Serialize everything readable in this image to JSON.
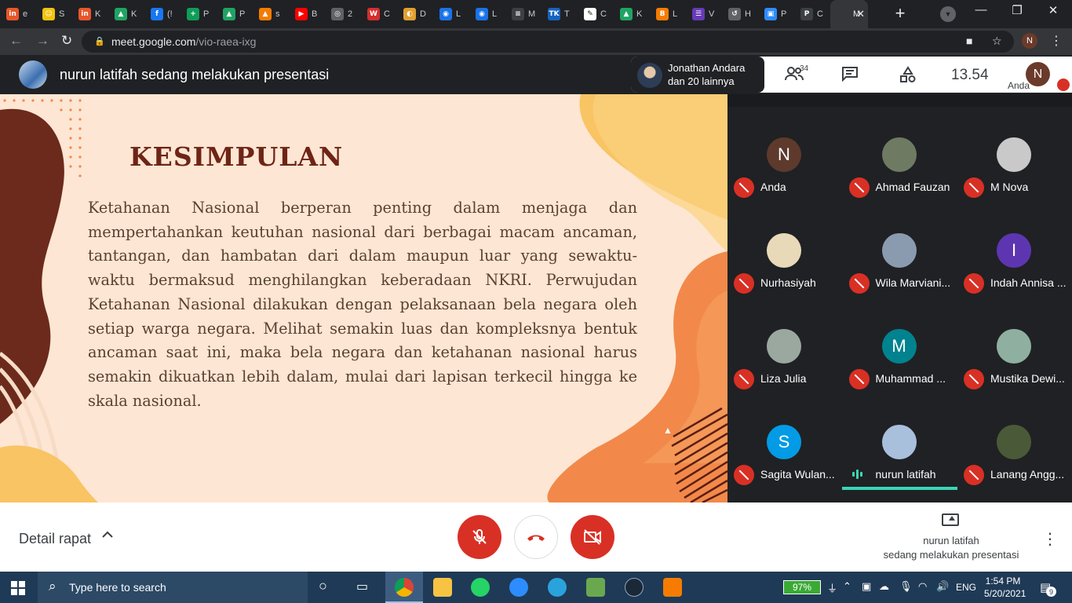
{
  "browser": {
    "tabs": [
      {
        "title": "e",
        "favicon": "in",
        "color": "#e8562a"
      },
      {
        "title": "S",
        "favicon": "☺",
        "color": "#f4c20d"
      },
      {
        "title": "K",
        "favicon": "in",
        "color": "#e8562a"
      },
      {
        "title": "K",
        "favicon": "▲",
        "color": "#1fa463"
      },
      {
        "title": "(!",
        "favicon": "f",
        "color": "#1877f2"
      },
      {
        "title": "P",
        "favicon": "+",
        "color": "#0f9d58"
      },
      {
        "title": "P",
        "favicon": "▲",
        "color": "#1fa463"
      },
      {
        "title": "s",
        "favicon": "▲",
        "color": "#f57c00"
      },
      {
        "title": "B",
        "favicon": "▶",
        "color": "#ff0000"
      },
      {
        "title": "2",
        "favicon": "◎",
        "color": "#5f6368"
      },
      {
        "title": "C",
        "favicon": "W",
        "color": "#d32f2f"
      },
      {
        "title": "D",
        "favicon": "◐",
        "color": "#e0a030"
      },
      {
        "title": "L",
        "favicon": "◉",
        "color": "#1a73e8"
      },
      {
        "title": "L",
        "favicon": "◉",
        "color": "#1a73e8"
      },
      {
        "title": "M",
        "favicon": "≡",
        "color": "#3c4043"
      },
      {
        "title": "T",
        "favicon": "TK",
        "color": "#1565c0"
      },
      {
        "title": "C",
        "favicon": "✎",
        "color": "#ffffff"
      },
      {
        "title": "K",
        "favicon": "▲",
        "color": "#1fa463"
      },
      {
        "title": "L",
        "favicon": "B",
        "color": "#f57c00"
      },
      {
        "title": "V",
        "favicon": "☰",
        "color": "#673ab7"
      },
      {
        "title": "H",
        "favicon": "↺",
        "color": "#5f6368"
      },
      {
        "title": "P",
        "favicon": "▣",
        "color": "#2d8cff"
      },
      {
        "title": "C",
        "favicon": "P",
        "color": "#3c4043"
      },
      {
        "title": "M",
        "favicon": "",
        "color": "#35363a"
      }
    ],
    "new_tab": "+",
    "url_host": "meet.google.com",
    "url_path": "/vio-raea-ixg",
    "profile_initial": "N",
    "window_controls": {
      "minimize": "—",
      "restore": "❐",
      "close": "✕"
    }
  },
  "meet_header": {
    "presenter_title": "nurun latifah sedang melakukan presentasi",
    "pinned_line1": "Jonathan Andara",
    "pinned_line2": "dan 20 lainnya",
    "participant_count": "34",
    "time": "13.54",
    "self_label": "Anda",
    "self_initial": "N"
  },
  "slide": {
    "title": "KESIMPULAN",
    "body": "Ketahanan Nasional berperan penting dalam menjaga dan mempertahankan keutuhan nasional dari berbagai macam ancaman, tantangan, dan hambatan dari dalam maupun luar yang sewaktu-waktu bermaksud menghilangkan keberadaan NKRI.  Perwujudan Ketahanan Nasional dilakukan dengan pelaksanaan bela negara oleh setiap warga negara. Melihat semakin luas dan kompleksnya bentuk ancaman saat ini, maka bela negara dan ketahanan nasional harus semakin dikuatkan lebih dalam, mulai dari lapisan terkecil hingga ke skala nasional."
  },
  "participants": [
    {
      "name": "Anda",
      "initial": "N",
      "color": "#5d3a2c",
      "muted": true
    },
    {
      "name": "Ahmad Fauzan",
      "initial": "",
      "color": "#6f7a63",
      "muted": true
    },
    {
      "name": "M Nova",
      "initial": "",
      "color": "#c9c9c9",
      "muted": true
    },
    {
      "name": "Nurhasiyah",
      "initial": "",
      "color": "#e8d9b8",
      "muted": true
    },
    {
      "name": "Wila Marviani...",
      "initial": "",
      "color": "#8a9bb0",
      "muted": true
    },
    {
      "name": "Indah Annisa ...",
      "initial": "I",
      "color": "#5e35b1",
      "muted": true
    },
    {
      "name": "Liza Julia",
      "initial": "",
      "color": "#9aa8a0",
      "muted": true
    },
    {
      "name": "Muhammad ...",
      "initial": "M",
      "color": "#00838f",
      "muted": true
    },
    {
      "name": "Mustika Dewi...",
      "initial": "",
      "color": "#8fb0a0",
      "muted": true
    },
    {
      "name": "Sagita Wulan...",
      "initial": "S",
      "color": "#039be5",
      "muted": true
    },
    {
      "name": "nurun latifah",
      "initial": "",
      "color": "#a8c0dc",
      "muted": false
    },
    {
      "name": "Lanang Angg...",
      "initial": "",
      "color": "#4a5a38",
      "muted": true
    }
  ],
  "bottom_bar": {
    "details_label": "Detail rapat",
    "present_line1": "nurun latifah",
    "present_line2": "sedang melakukan presentasi"
  },
  "taskbar": {
    "search_placeholder": "Type here to search",
    "battery": "97%",
    "language": "ENG",
    "time": "1:54 PM",
    "date": "5/20/2021",
    "notification_count": "9"
  },
  "colors": {
    "meet_red": "#d93025",
    "speaking_teal": "#3ad5b6",
    "slide_title": "#6e2416"
  }
}
